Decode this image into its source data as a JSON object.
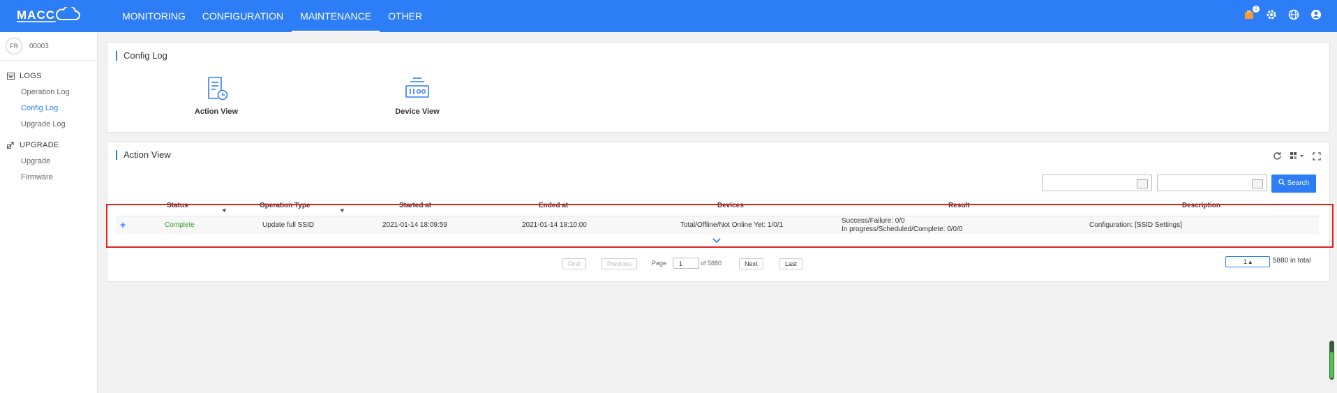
{
  "topbar": {
    "nav": [
      {
        "label": "MONITORING"
      },
      {
        "label": "CONFIGURATION"
      },
      {
        "label": "MAINTENANCE",
        "active": true
      },
      {
        "label": "OTHER"
      }
    ],
    "notification_badge": "1",
    "icons": [
      "bell-icon",
      "gear-icon",
      "globe-icon",
      "user-icon"
    ],
    "accent": "#2d7df6"
  },
  "sidebar": {
    "avatar": "FR",
    "account_id": "00003",
    "sections": [
      {
        "label": "LOGS",
        "items": [
          "Operation Log",
          "Config Log",
          "Upgrade Log"
        ],
        "active": "Config Log"
      },
      {
        "label": "UPGRADE",
        "items": [
          "Upgrade",
          "Firmware"
        ]
      }
    ]
  },
  "config_panel": {
    "title": "Config Log",
    "views": [
      {
        "label": "Action View",
        "icon": "document-clock-icon"
      },
      {
        "label": "Device View",
        "icon": "device-ports-icon"
      }
    ]
  },
  "action_panel": {
    "title": "Action View",
    "search_label": "Search",
    "columns": [
      "Status",
      "Operation Type",
      "Started at",
      "Ended at",
      "Devices",
      "Result",
      "Description"
    ],
    "rows": [
      {
        "expand": "+",
        "status": "Complete",
        "operation_type": "Update full SSID",
        "started_at": "2021-01-14 18:09:59",
        "ended_at": "2021-01-14 18:10:00",
        "devices": "Total/Offline/Not Online Yet: 1/0/1",
        "result_line1": "Success/Failure: 0/0",
        "result_line2": "In progress/Scheduled/Complete: 0/0/0",
        "description": "Configuration: [SSID Settings]"
      }
    ]
  },
  "pagination": {
    "first": "First",
    "previous": "Previous",
    "page_label": "Page",
    "page_value": "1",
    "of_label": "of 5880",
    "next": "Next",
    "last": "Last",
    "page_size": "1 ▴",
    "total": "5880 in total"
  }
}
